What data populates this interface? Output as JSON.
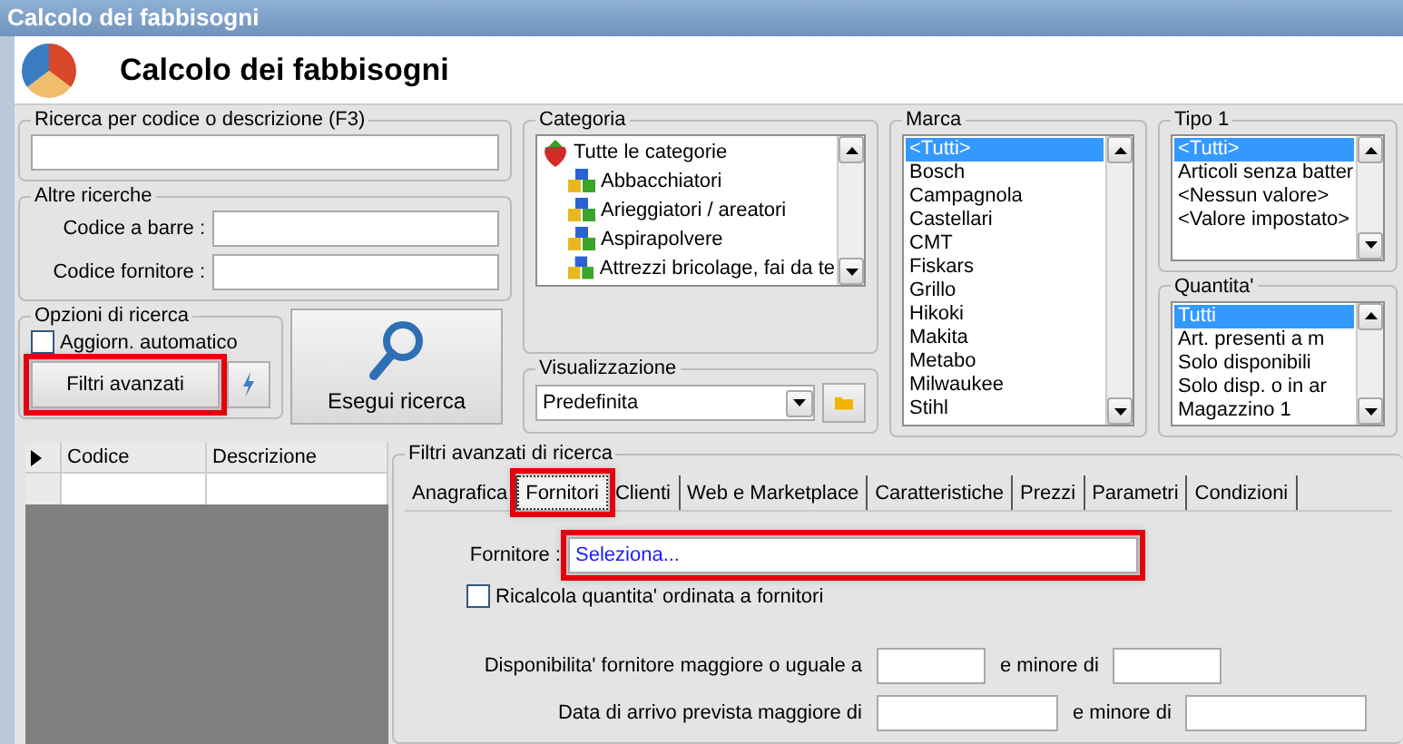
{
  "window": {
    "title": "Calcolo dei fabbisogni"
  },
  "header": {
    "title": "Calcolo dei fabbisogni"
  },
  "search": {
    "title": "Ricerca per codice o descrizione (F3)"
  },
  "other_searches": {
    "title": "Altre ricerche",
    "fields": [
      {
        "label": "Codice a barre :"
      },
      {
        "label": "Codice fornitore :"
      }
    ]
  },
  "search_options": {
    "title": "Opzioni di ricerca",
    "auto_update": {
      "label": "Aggiorn. automatico",
      "checked": false
    },
    "advanced_button": {
      "label": "Filtri avanzati",
      "highlighted": true
    }
  },
  "run_button": {
    "label": "Esegui ricerca"
  },
  "category": {
    "title": "Categoria",
    "tree": [
      {
        "label": "Tutte le categorie",
        "kind": "root",
        "children": [
          {
            "label": "Abbacchiatori",
            "kind": "group"
          },
          {
            "label": "Arieggiatori / areatori",
            "kind": "group"
          },
          {
            "label": "Aspirapolvere",
            "kind": "group"
          },
          {
            "label": "Attrezzi bricolage, fai da te",
            "kind": "group"
          }
        ]
      }
    ]
  },
  "view": {
    "title": "Visualizzazione",
    "value": "Predefinita"
  },
  "brand": {
    "title": "Marca",
    "items": [
      {
        "label": "<Tutti>",
        "selected": true
      },
      {
        "label": "Bosch",
        "selected": false
      },
      {
        "label": "Campagnola",
        "selected": false
      },
      {
        "label": "Castellari",
        "selected": false
      },
      {
        "label": "CMT",
        "selected": false
      },
      {
        "label": "Fiskars",
        "selected": false
      },
      {
        "label": "Grillo",
        "selected": false
      },
      {
        "label": "Hikoki",
        "selected": false
      },
      {
        "label": "Makita",
        "selected": false
      },
      {
        "label": "Metabo",
        "selected": false
      },
      {
        "label": "Milwaukee",
        "selected": false
      },
      {
        "label": "Stihl",
        "selected": false
      }
    ]
  },
  "type1": {
    "title": "Tipo 1",
    "items": [
      {
        "label": "<Tutti>",
        "selected": true
      },
      {
        "label": "Articoli senza batter",
        "selected": false
      },
      {
        "label": "<Nessun valore>",
        "selected": false
      },
      {
        "label": "<Valore impostato>",
        "selected": false
      }
    ]
  },
  "quantity": {
    "title": "Quantita'",
    "items": [
      {
        "label": "Tutti",
        "selected": true
      },
      {
        "label": "Art. presenti a m",
        "selected": false
      },
      {
        "label": "Solo disponibili",
        "selected": false
      },
      {
        "label": "Solo disp. o in ar",
        "selected": false
      },
      {
        "label": "Magazzino 1",
        "selected": false
      }
    ]
  },
  "grid": {
    "columns": [
      "Codice",
      "Descrizione"
    ]
  },
  "advanced_filters": {
    "title": "Filtri avanzati di ricerca",
    "tabs": [
      {
        "label": "Anagrafica",
        "selected": false,
        "highlighted": false
      },
      {
        "label": "Fornitori",
        "selected": true,
        "highlighted": true
      },
      {
        "label": "Clienti",
        "selected": false,
        "highlighted": false
      },
      {
        "label": "Web e Marketplace",
        "selected": false,
        "highlighted": false
      },
      {
        "label": "Caratteristiche",
        "selected": false,
        "highlighted": false
      },
      {
        "label": "Prezzi",
        "selected": false,
        "highlighted": false
      },
      {
        "label": "Parametri",
        "selected": false,
        "highlighted": false
      },
      {
        "label": "Condizioni",
        "selected": false,
        "highlighted": false
      }
    ],
    "supplier": {
      "label": "Fornitore :",
      "value": "Seleziona...",
      "highlighted": true
    },
    "recalc": {
      "label": "Ricalcola quantita' ordinata a fornitori",
      "checked": false
    },
    "ranges": [
      {
        "label": "Disponibilita' fornitore maggiore o uguale a",
        "between": "e minore di"
      },
      {
        "label": "Data di arrivo prevista maggiore di",
        "between": "e minore di"
      }
    ]
  }
}
